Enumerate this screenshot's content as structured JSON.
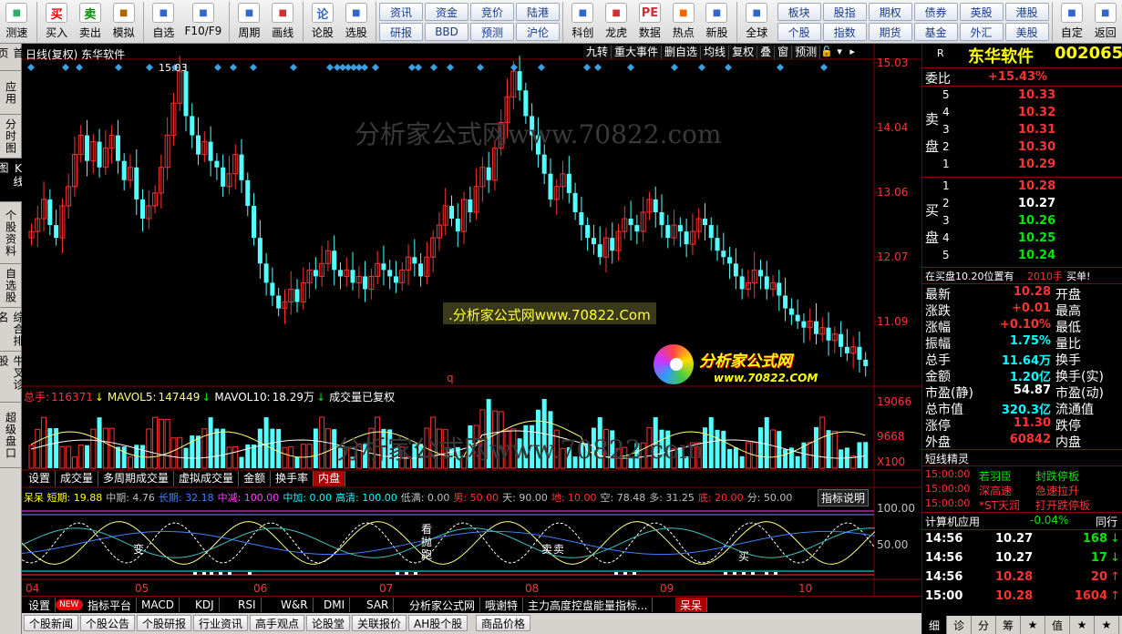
{
  "toolbar": {
    "buttons": [
      {
        "label": "测速",
        "icon": "clock-icon",
        "color": "#3a6"
      },
      {
        "label": "买入",
        "icon": "buy-icon",
        "glyph": "买",
        "color": "#e00"
      },
      {
        "label": "卖出",
        "icon": "sell-icon",
        "glyph": "卖",
        "color": "#080"
      },
      {
        "label": "模拟",
        "icon": "hammer-icon",
        "color": "#a60"
      },
      {
        "label": "自选",
        "icon": "star-icon",
        "color": "#36c"
      },
      {
        "label": "F10/F9",
        "icon": "document-icon",
        "color": "#36c"
      },
      {
        "label": "周期",
        "icon": "cycle-icon",
        "color": "#36c"
      },
      {
        "label": "画线",
        "icon": "pencil-icon",
        "color": "#c33"
      },
      {
        "label": "论股",
        "icon": "discuss-icon",
        "glyph": "论",
        "color": "#36c"
      },
      {
        "label": "选股",
        "icon": "stock-select-icon",
        "color": "#36c"
      }
    ],
    "grid1": [
      "资讯",
      "资金",
      "竞价",
      "陆港",
      "研报",
      "BBD",
      "预测",
      "沪伦"
    ],
    "buttons2": [
      {
        "label": "科创",
        "icon": "kechuang-icon",
        "color": "#36c"
      },
      {
        "label": "龙虎",
        "icon": "dragon-icon",
        "color": "#c33"
      },
      {
        "label": "数据",
        "icon": "pe-icon",
        "glyph": "PE",
        "color": "#c33"
      },
      {
        "label": "热点",
        "icon": "fire-icon",
        "color": "#e60"
      },
      {
        "label": "新股",
        "icon": "ipo-icon",
        "color": "#36c"
      },
      {
        "label": "全球",
        "icon": "globe-icon",
        "color": "#36c"
      }
    ],
    "grid2": [
      "板块",
      "股指",
      "期权",
      "债券",
      "英股",
      "港股",
      "个股",
      "指数",
      "期货",
      "基金",
      "外汇",
      "美股"
    ],
    "buttons3": [
      {
        "label": "自定",
        "icon": "custom-icon",
        "color": "#36c"
      },
      {
        "label": "返回",
        "icon": "back-icon",
        "color": "#36c"
      }
    ]
  },
  "left_tabs": [
    "首页",
    "应用",
    "分时图",
    "K线图",
    "个股资料",
    "自选股",
    "综合排名",
    "牛叉诊股",
    "超级盘口"
  ],
  "left_active": "K线图",
  "chart": {
    "header_left": "日线(复权) 东华软件",
    "header_tools": [
      "九转",
      "重大事件",
      "删自选",
      "均线",
      "复权",
      "叠",
      "窗",
      "预测"
    ],
    "high_label": "15.03",
    "price_axis": [
      "15.03",
      "14.04",
      "13.06",
      "12.07",
      "11.09"
    ],
    "volume_axis": [
      "19066",
      "9668",
      "X100"
    ],
    "indicator_axis": [
      "100.00",
      "50.00"
    ],
    "date_axis": [
      "04",
      "05",
      "06",
      "07",
      "08",
      "09",
      "10"
    ],
    "watermark1": "分析家公式网www.70822.com",
    "watermark2": "分析家公式网www.70822.com",
    "banner": ".分析家公式网www.70822.Com",
    "logo_text": "分析家公式网",
    "logo_url": "www.70822.COM",
    "low_marker": "q",
    "volume_legend": {
      "total_label": "总手:",
      "total": "116371",
      "ma5_label": "MAVOL5:",
      "ma5": "147449",
      "ma10_label": "MAVOL10:",
      "ma10": "18.29万",
      "note": "成交量已复权"
    },
    "volume_tabs": [
      "设置",
      "成交量",
      "多周期成交量",
      "虚拟成交量",
      "金额",
      "换手率",
      "内盘"
    ],
    "indicator_legend": [
      {
        "text": "呆呆 短期: 19.88",
        "color": "#ffff00"
      },
      {
        "text": "中期: 4.76",
        "color": "#c0c0c0"
      },
      {
        "text": "长期: 32.18",
        "color": "#4080ff"
      },
      {
        "text": "中减: 100.00",
        "color": "#ff40ff"
      },
      {
        "text": "中加: 0.00",
        "color": "#00ffff"
      },
      {
        "text": "高清: 100.00",
        "color": "#00ffff"
      },
      {
        "text": "低满: 0.00",
        "color": "#c0c0c0"
      },
      {
        "text": "男: 50.00",
        "color": "#ff3232"
      },
      {
        "text": "天: 90.00",
        "color": "#c0c0c0"
      },
      {
        "text": "地: 10.00",
        "color": "#ff3232"
      },
      {
        "text": "空: 78.48",
        "color": "#c0c0c0"
      },
      {
        "text": "多: 31.25",
        "color": "#c0c0c0"
      },
      {
        "text": "底: 20.00",
        "color": "#ff3232"
      },
      {
        "text": "分: 50.00",
        "color": "#c0c0c0"
      }
    ],
    "indicator_btn": "指标说明",
    "indicator_notes": [
      "变",
      "看",
      "抛",
      "跑",
      "卖",
      "卖",
      "买"
    ],
    "bottom_tabs1": [
      "设置",
      "NEW",
      "指标平台",
      "MACD",
      "KDJ",
      "RSI",
      "W&R",
      "DMI",
      "SAR",
      "分析家公式网",
      "哦谢特",
      "主力高度控盘能量指标...",
      "呆呆"
    ],
    "bottom_tabs2": [
      "个股新闻",
      "个股公告",
      "个股研报",
      "行业资讯",
      "高手观点",
      "论股堂",
      "关联报价",
      "AH股个股",
      "商品价格"
    ]
  },
  "quote": {
    "flag": "R",
    "name": "东华软件",
    "code": "002065",
    "weibi_label": "委比",
    "weibi": "+15.43%",
    "sell_label": "卖盘",
    "buy_label": "买盘",
    "sells": [
      {
        "n": "5",
        "p": "10.33"
      },
      {
        "n": "4",
        "p": "10.32"
      },
      {
        "n": "3",
        "p": "10.31"
      },
      {
        "n": "2",
        "p": "10.30"
      },
      {
        "n": "1",
        "p": "10.29"
      }
    ],
    "buys": [
      {
        "n": "1",
        "p": "10.28",
        "c": "#ff3232"
      },
      {
        "n": "2",
        "p": "10.27",
        "c": "#ffffff"
      },
      {
        "n": "3",
        "p": "10.26",
        "c": "#00e600"
      },
      {
        "n": "4",
        "p": "10.25",
        "c": "#00e600"
      },
      {
        "n": "5",
        "p": "10.24",
        "c": "#00e600"
      }
    ],
    "notice_pre": "在买盘10.20位置有",
    "notice_num": "2010手",
    "notice_post": "买单!",
    "stats": [
      {
        "l": "最新",
        "v": "10.28",
        "vc": "#ff3232",
        "r": "开盘"
      },
      {
        "l": "涨跌",
        "v": "+0.01",
        "vc": "#ff3232",
        "r": "最高"
      },
      {
        "l": "涨幅",
        "v": "+0.10%",
        "vc": "#ff3232",
        "r": "最低"
      },
      {
        "l": "振幅",
        "v": "1.75%",
        "vc": "#00ffff",
        "r": "量比"
      },
      {
        "l": "总手",
        "v": "11.64万",
        "vc": "#00ffff",
        "r": "换手"
      },
      {
        "l": "金额",
        "v": "1.20亿",
        "vc": "#00ffff",
        "r": "换手(实)"
      },
      {
        "l": "市盈(静)",
        "v": "54.87",
        "vc": "#ffffff",
        "r": "市盈(动)"
      },
      {
        "l": "总市值",
        "v": "320.3亿",
        "vc": "#00ffff",
        "r": "流通值"
      },
      {
        "l": "涨停",
        "v": "11.30",
        "vc": "#ff3232",
        "r": "跌停"
      },
      {
        "l": "外盘",
        "v": "60842",
        "vc": "#ff3232",
        "r": "内盘"
      }
    ],
    "spirit_title": "短线精灵",
    "spirit": [
      {
        "t": "15:00:00",
        "n": "若羽臣",
        "e": "封跌停板",
        "nc": "#00e600",
        "ec": "#00e600"
      },
      {
        "t": "15:00:00",
        "n": "深高速",
        "e": "急速拉升",
        "nc": "#ff3232",
        "ec": "#ff3232"
      },
      {
        "t": "15:00:00",
        "n": "*ST天润",
        "e": "打开跌停板",
        "nc": "#ff3232",
        "ec": "#ff3232"
      }
    ],
    "sector_name": "计算机应用",
    "sector_pct": "-0.04%",
    "sector_extra": "同行",
    "ticks": [
      {
        "t": "14:56",
        "p": "10.27",
        "pc": "#ffffff",
        "v": "168",
        "vc": "#00e600",
        "a": "↓"
      },
      {
        "t": "14:56",
        "p": "10.27",
        "pc": "#ffffff",
        "v": "17",
        "vc": "#00e600",
        "a": "↓"
      },
      {
        "t": "14:56",
        "p": "10.28",
        "pc": "#ff3232",
        "v": "20",
        "vc": "#ff3232",
        "a": "↑"
      },
      {
        "t": "15:00",
        "p": "10.28",
        "pc": "#ff3232",
        "v": "1604",
        "vc": "#ff3232",
        "a": "↑"
      }
    ],
    "bottom_tabs": [
      "细",
      "诊",
      "分",
      "筹",
      "★",
      "值",
      "★",
      "★"
    ]
  }
}
